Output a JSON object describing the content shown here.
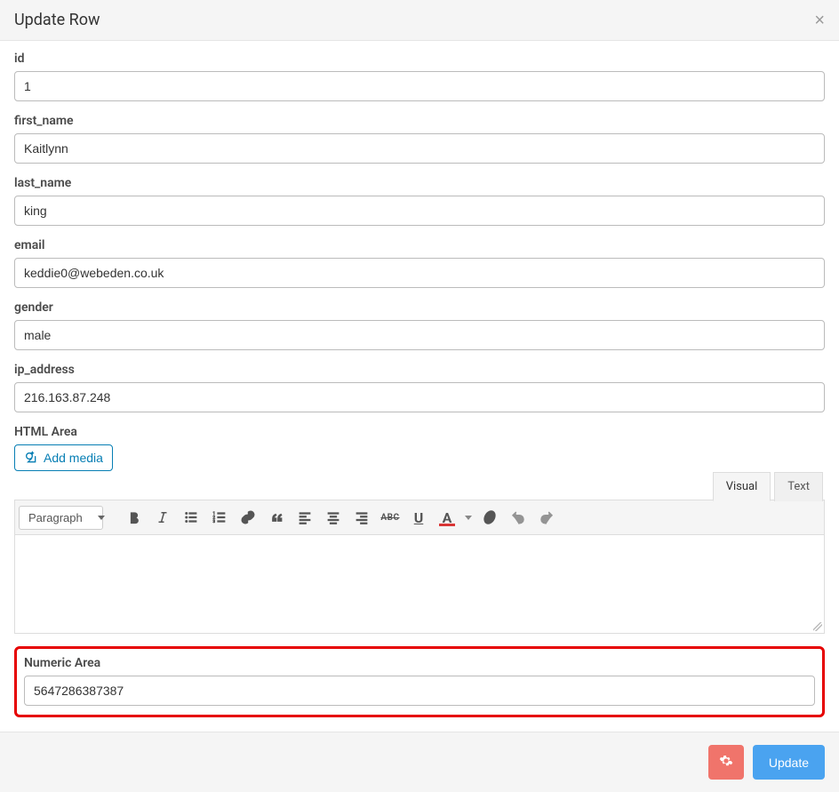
{
  "header": {
    "title": "Update Row"
  },
  "fields": {
    "id": {
      "label": "id",
      "value": "1"
    },
    "first_name": {
      "label": "first_name",
      "value": "Kaitlynn"
    },
    "last_name": {
      "label": "last_name",
      "value": "king"
    },
    "email": {
      "label": "email",
      "value": "keddie0@webeden.co.uk"
    },
    "gender": {
      "label": "gender",
      "value": "male"
    },
    "ip_address": {
      "label": "ip_address",
      "value": "216.163.87.248"
    },
    "html_area": {
      "label": "HTML Area"
    },
    "numeric_area": {
      "label": "Numeric Area",
      "value": "5647286387387"
    }
  },
  "editor": {
    "add_media_label": "Add media",
    "tabs": {
      "visual": "Visual",
      "text": "Text"
    },
    "format_select": "Paragraph",
    "content": ""
  },
  "footer": {
    "update_label": "Update"
  }
}
